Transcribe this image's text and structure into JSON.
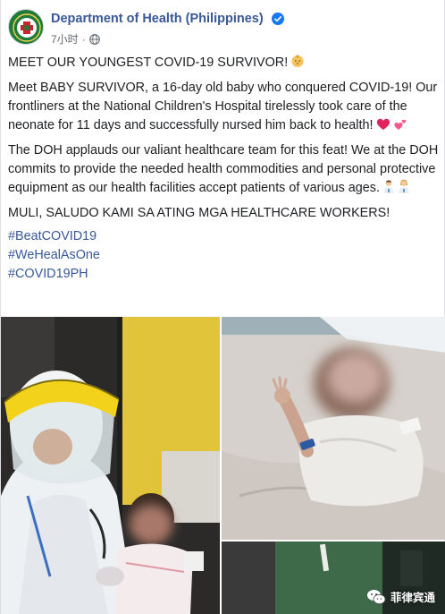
{
  "post": {
    "page_name": "Department of Health (Philippines)",
    "time": "7小时",
    "privacy_icon": "globe-icon",
    "verified_icon": "verified-badge-icon",
    "paragraphs": {
      "p1": "MEET OUR YOUNGEST COVID-19 SURVIVOR!",
      "p2": "Meet BABY SURVIVOR, a 16-day old baby who conquered COVID-19! Our frontliners at the National Children's Hospital tirelessly took care of the neonate for 11 days and successfully nursed him back to health!",
      "p3": "The DOH applauds our valiant healthcare team for this feat! We at the DOH commits to provide the needed health commodities and personal protective equipment as our health facilities accept patients of various ages.",
      "p4": "MULI, SALUDO KAMI SA ATING MGA HEALTHCARE WORKERS!"
    },
    "hashtags": [
      "#BeatCOVID19",
      "#WeHealAsOne",
      "#COVID19PH"
    ],
    "emojis": {
      "p1": "baby-face-emoji",
      "p2": [
        "red-heart-emoji",
        "two-hearts-emoji"
      ],
      "p3": [
        "health-worker-man-emoji",
        "health-worker-woman-emoji"
      ]
    }
  },
  "watermark": {
    "icon": "wechat-icon",
    "text": "菲律宾通"
  }
}
